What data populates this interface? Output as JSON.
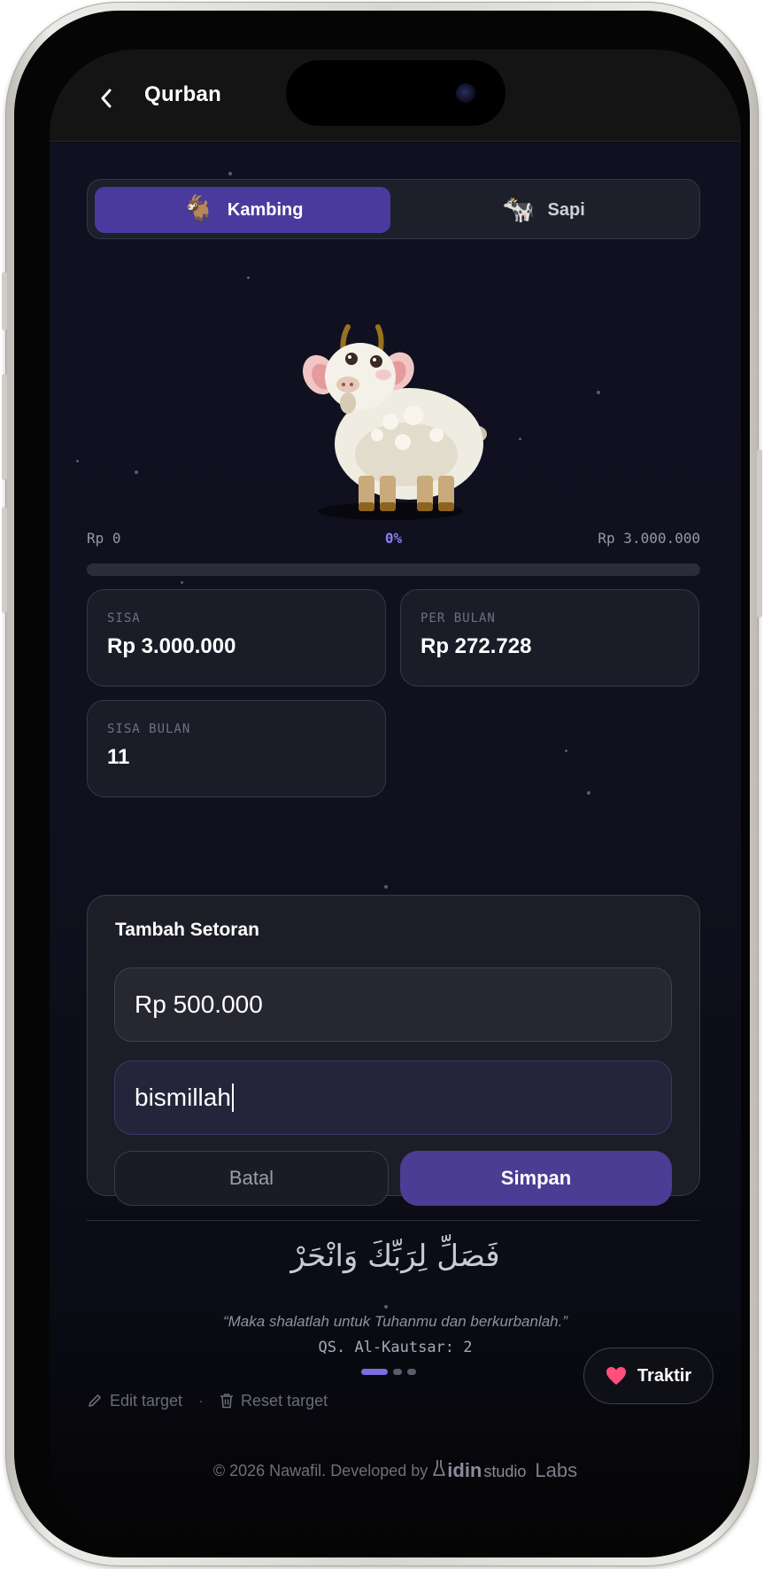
{
  "header": {
    "title": "Qurban"
  },
  "toggle": {
    "options": [
      {
        "emoji": "🐐",
        "label": "Kambing",
        "active": true
      },
      {
        "emoji": "🐄",
        "label": "Sapi",
        "active": false
      }
    ]
  },
  "progress": {
    "min_label": "Rp 0",
    "percent_label": "0%",
    "max_label": "Rp 3.000.000",
    "fraction": 0
  },
  "stats": {
    "sisa": {
      "label": "SISA",
      "value": "Rp 3.000.000"
    },
    "per_bulan": {
      "label": "PER BULAN",
      "value": "Rp 272.728"
    },
    "sisa_bulan": {
      "label": "SISA BULAN",
      "value": "11"
    }
  },
  "form": {
    "title": "Tambah Setoran",
    "amount_value": "Rp 500.000",
    "note_value": "bismillah",
    "cancel_label": "Batal",
    "save_label": "Simpan"
  },
  "verse": {
    "arabic": "فَصَلِّ لِرَبِّكَ وَانْحَرْ",
    "translation": "“Maka shalatlah untuk Tuhanmu dan berkurbanlah.”",
    "reference": "QS. Al-Kautsar: 2"
  },
  "traktir": {
    "label": "Traktir",
    "icon": "heart-icon",
    "icon_color": "#ff4f7a"
  },
  "actions": {
    "edit_label": "Edit target",
    "reset_label": "Reset target"
  },
  "footer": {
    "text": "© 2026 Nawafil. Developed by",
    "brand_main": "idin",
    "brand_sub": "studio",
    "brand_labs": "Labs"
  },
  "colors": {
    "accent": "#4a3a9e",
    "progress_accent": "#8d7cf0",
    "background": "#0f1020"
  }
}
